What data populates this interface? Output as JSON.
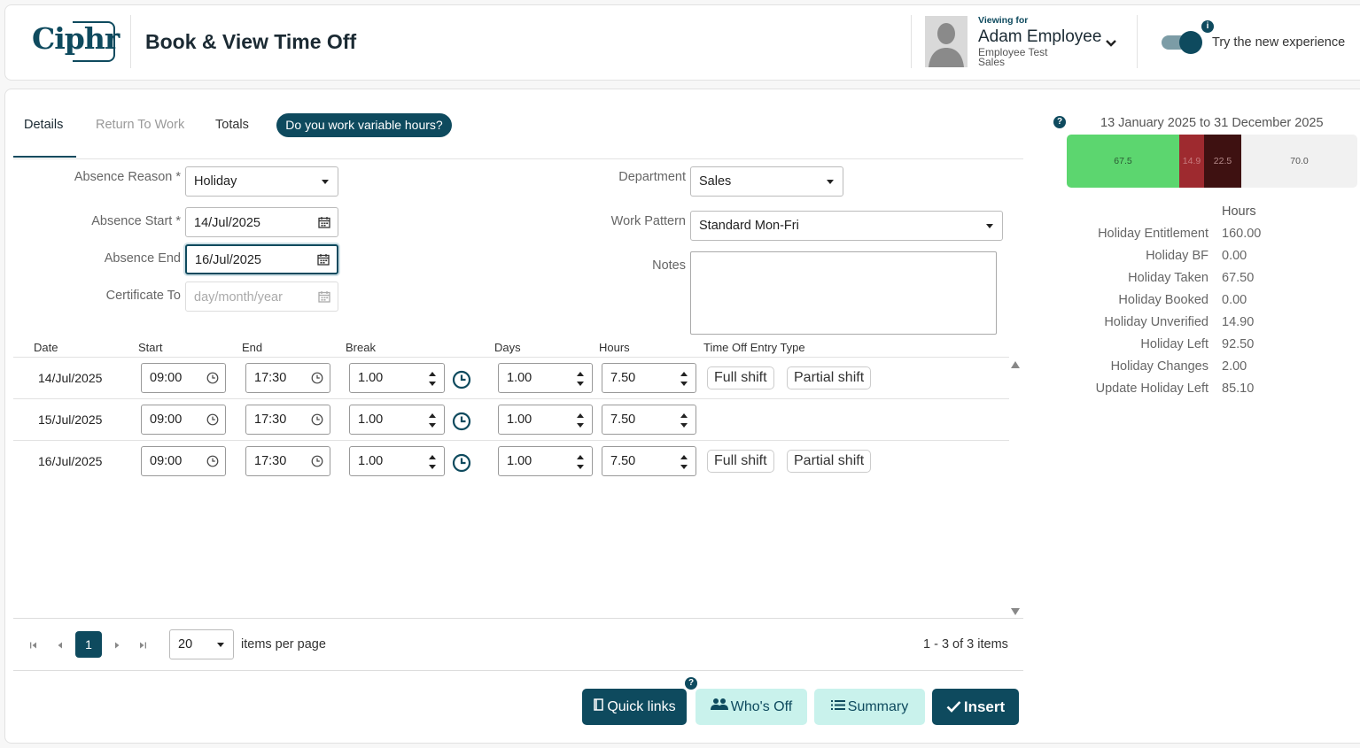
{
  "header": {
    "logo_text": "Ciphr",
    "title": "Book & View Time Off",
    "viewing_for": "Viewing for",
    "employee_name": "Adam Employee",
    "employee_sub1": "Employee Test",
    "employee_sub2": "Sales",
    "toggle_on": true,
    "try_new_label": "Try the new experience",
    "info_glyph": "i"
  },
  "tabs": {
    "details": "Details",
    "return_to_work": "Return To Work",
    "totals": "Totals",
    "variable_hours": "Do you work variable hours?"
  },
  "form": {
    "absence_reason_label": "Absence Reason *",
    "absence_reason_value": "Holiday",
    "absence_start_label": "Absence Start *",
    "absence_start_value": "14/Jul/2025",
    "absence_end_label": "Absence End",
    "absence_end_value": "16/Jul/2025",
    "certificate_to_label": "Certificate To",
    "certificate_to_placeholder": "day/month/year",
    "department_label": "Department",
    "department_value": "Sales",
    "work_pattern_label": "Work Pattern",
    "work_pattern_value": "Standard Mon-Fri",
    "notes_label": "Notes",
    "notes_value": ""
  },
  "grid": {
    "columns": {
      "date": "Date",
      "start": "Start",
      "end": "End",
      "break": "Break",
      "days": "Days",
      "hours": "Hours",
      "type": "Time Off Entry Type"
    },
    "rows": [
      {
        "date": "14/Jul/2025",
        "start": "09:00",
        "end": "17:30",
        "break": "1.00",
        "days": "1.00",
        "hours": "7.50",
        "full_shift": "Full shift",
        "partial_shift": "Partial shift"
      },
      {
        "date": "15/Jul/2025",
        "start": "09:00",
        "end": "17:30",
        "break": "1.00",
        "days": "1.00",
        "hours": "7.50",
        "full_shift": "",
        "partial_shift": ""
      },
      {
        "date": "16/Jul/2025",
        "start": "09:00",
        "end": "17:30",
        "break": "1.00",
        "days": "1.00",
        "hours": "7.50",
        "full_shift": "Full shift",
        "partial_shift": "Partial shift"
      }
    ]
  },
  "pager": {
    "current_page": "1",
    "per_page": "20",
    "per_page_label": "items per page",
    "items_info": "1 - 3 of 3 items"
  },
  "actions": {
    "quick_links": "Quick links",
    "whos_off": "Who's Off",
    "summary": "Summary",
    "insert": "Insert",
    "help_glyph": "?"
  },
  "sidebar": {
    "help_glyph": "?",
    "date_range": "13 January 2025 to 31 December 2025",
    "bar": [
      {
        "label": "67.5",
        "value": 67.5,
        "color": "#5cd66f",
        "text_color": "#2a5a33"
      },
      {
        "label": "14.9",
        "value": 14.9,
        "color": "#9e2a2f",
        "text_color": "#c77b7e"
      },
      {
        "label": "22.5",
        "value": 22.5,
        "color": "#3e1111",
        "text_color": "#b58a8a"
      },
      {
        "label": "70.0",
        "value": 70.0,
        "color": "#f1f1f1",
        "text_color": "#555555"
      }
    ],
    "hours_header": "Hours",
    "stats": [
      {
        "label": "Holiday Entitlement",
        "value": "160.00"
      },
      {
        "label": "Holiday BF",
        "value": "0.00"
      },
      {
        "label": "Holiday Taken",
        "value": "67.50"
      },
      {
        "label": "Holiday Booked",
        "value": "0.00"
      },
      {
        "label": "Holiday Unverified",
        "value": "14.90"
      },
      {
        "label": "Holiday Left",
        "value": "92.50"
      },
      {
        "label": "Holiday Changes",
        "value": "2.00"
      },
      {
        "label": "Update Holiday Left",
        "value": "85.10"
      }
    ]
  },
  "colors": {
    "brand": "#0e4a5e",
    "accent_light": "#c9f2ec"
  }
}
